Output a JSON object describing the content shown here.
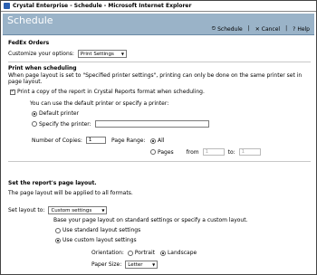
{
  "window": {
    "title": "Crystal Enterprise - Schedule - Microsoft Internet Explorer"
  },
  "banner": {
    "heading": "Schedule"
  },
  "toolbar": {
    "schedule_label": "Schedule",
    "cancel_label": "Cancel",
    "help_label": "Help",
    "separator": "|"
  },
  "report": {
    "name": "FedEx Orders",
    "customize_label": "Customize your options:",
    "customize_value": "Print Settings"
  },
  "print": {
    "title": "Print when scheduling",
    "description": "When page layout is set to \"Specified printer settings\", printing can only be done on the same printer set in page layout.",
    "checkbox_label": "Print a copy of the report in Crystal Reports format when scheduling.",
    "printer_intro": "You can use the default printer or specify a printer:",
    "default_printer_label": "Default printer",
    "specify_printer_label": "Specify the printer:",
    "specify_printer_value": "",
    "copies_label": "Number of Copies:",
    "copies_value": "1",
    "page_range_label": "Page Range:",
    "all_label": "All",
    "pages_label": "Pages",
    "from_label": "from",
    "from_value": "1",
    "to_label": "to:",
    "to_value": "1"
  },
  "layout": {
    "title": "Set the report's page layout.",
    "description": "The page layout will be applied to all formats.",
    "set_label": "Set layout to:",
    "set_value": "Custom settings",
    "intro": "Base your page layout on standard settings or specify a custom layout.",
    "standard_label": "Use standard layout settings",
    "custom_label": "Use custom layout settings",
    "orientation_label": "Orientation:",
    "portrait_label": "Portrait",
    "landscape_label": "Landscape",
    "paper_size_label": "Paper Size:",
    "paper_size_value": "Letter"
  }
}
